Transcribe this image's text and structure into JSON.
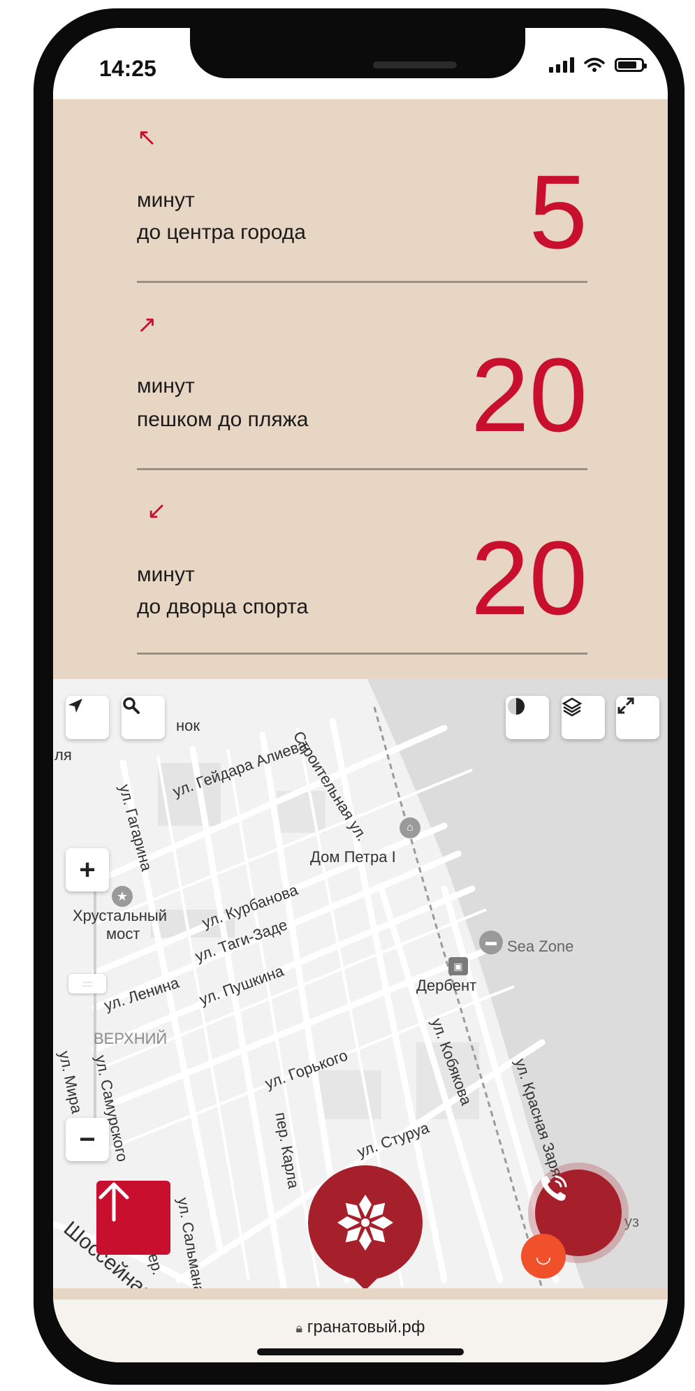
{
  "status_bar": {
    "time": "14:25"
  },
  "stats": [
    {
      "arrow": "↖",
      "line1": "минут",
      "line2": "до центра города",
      "value": "5"
    },
    {
      "arrow": "↗",
      "line1": "минут",
      "line2": "пешком до пляжа",
      "value": "20"
    },
    {
      "arrow": "↙",
      "line1": "минут",
      "line2": "до дворца спорта",
      "value": "20"
    }
  ],
  "map": {
    "labels": {
      "top_left": "нок",
      "heydar_aliev": "ул. Гейдара Алиева",
      "gagarina": "ул. Гагарина",
      "dom_petra": "Дом Петра I",
      "kurbanova": "ул. Курбанова",
      "taghi_zade": "ул. Таги-Заде",
      "crystal_bridge_1": "Хрустальный",
      "crystal_bridge_2": "мост",
      "pushkina": "ул. Пушкина",
      "lenina": "ул. Ленина",
      "verkhniy": "ВЕРХНИЙ",
      "sea_zone": "Sea Zone",
      "derbent": "Дербент",
      "gorkogo": "ул. Горького",
      "kobyakova": "ул. Кобякова",
      "krasnaya_zarya": "ул. Красная Заря",
      "mira": "ул. Мира",
      "samurskogo": "ул. Самурского",
      "karla": "пер. Карла",
      "sturua": "ул. Стуруа",
      "salmana": "ул. Сальмана",
      "shosseynaya": "Шоссейная",
      "stroitelnaya": "Строительная ул.",
      "left_edge": "ля",
      "per": "пер.",
      "uz": "уз"
    },
    "zoom_in": "+",
    "zoom_out": "−"
  },
  "url_bar": {
    "url": "гранатовый.рф"
  },
  "colors": {
    "accent": "#c8102e",
    "brand_dark": "#a5202a",
    "beige": "#e8d6c4"
  }
}
